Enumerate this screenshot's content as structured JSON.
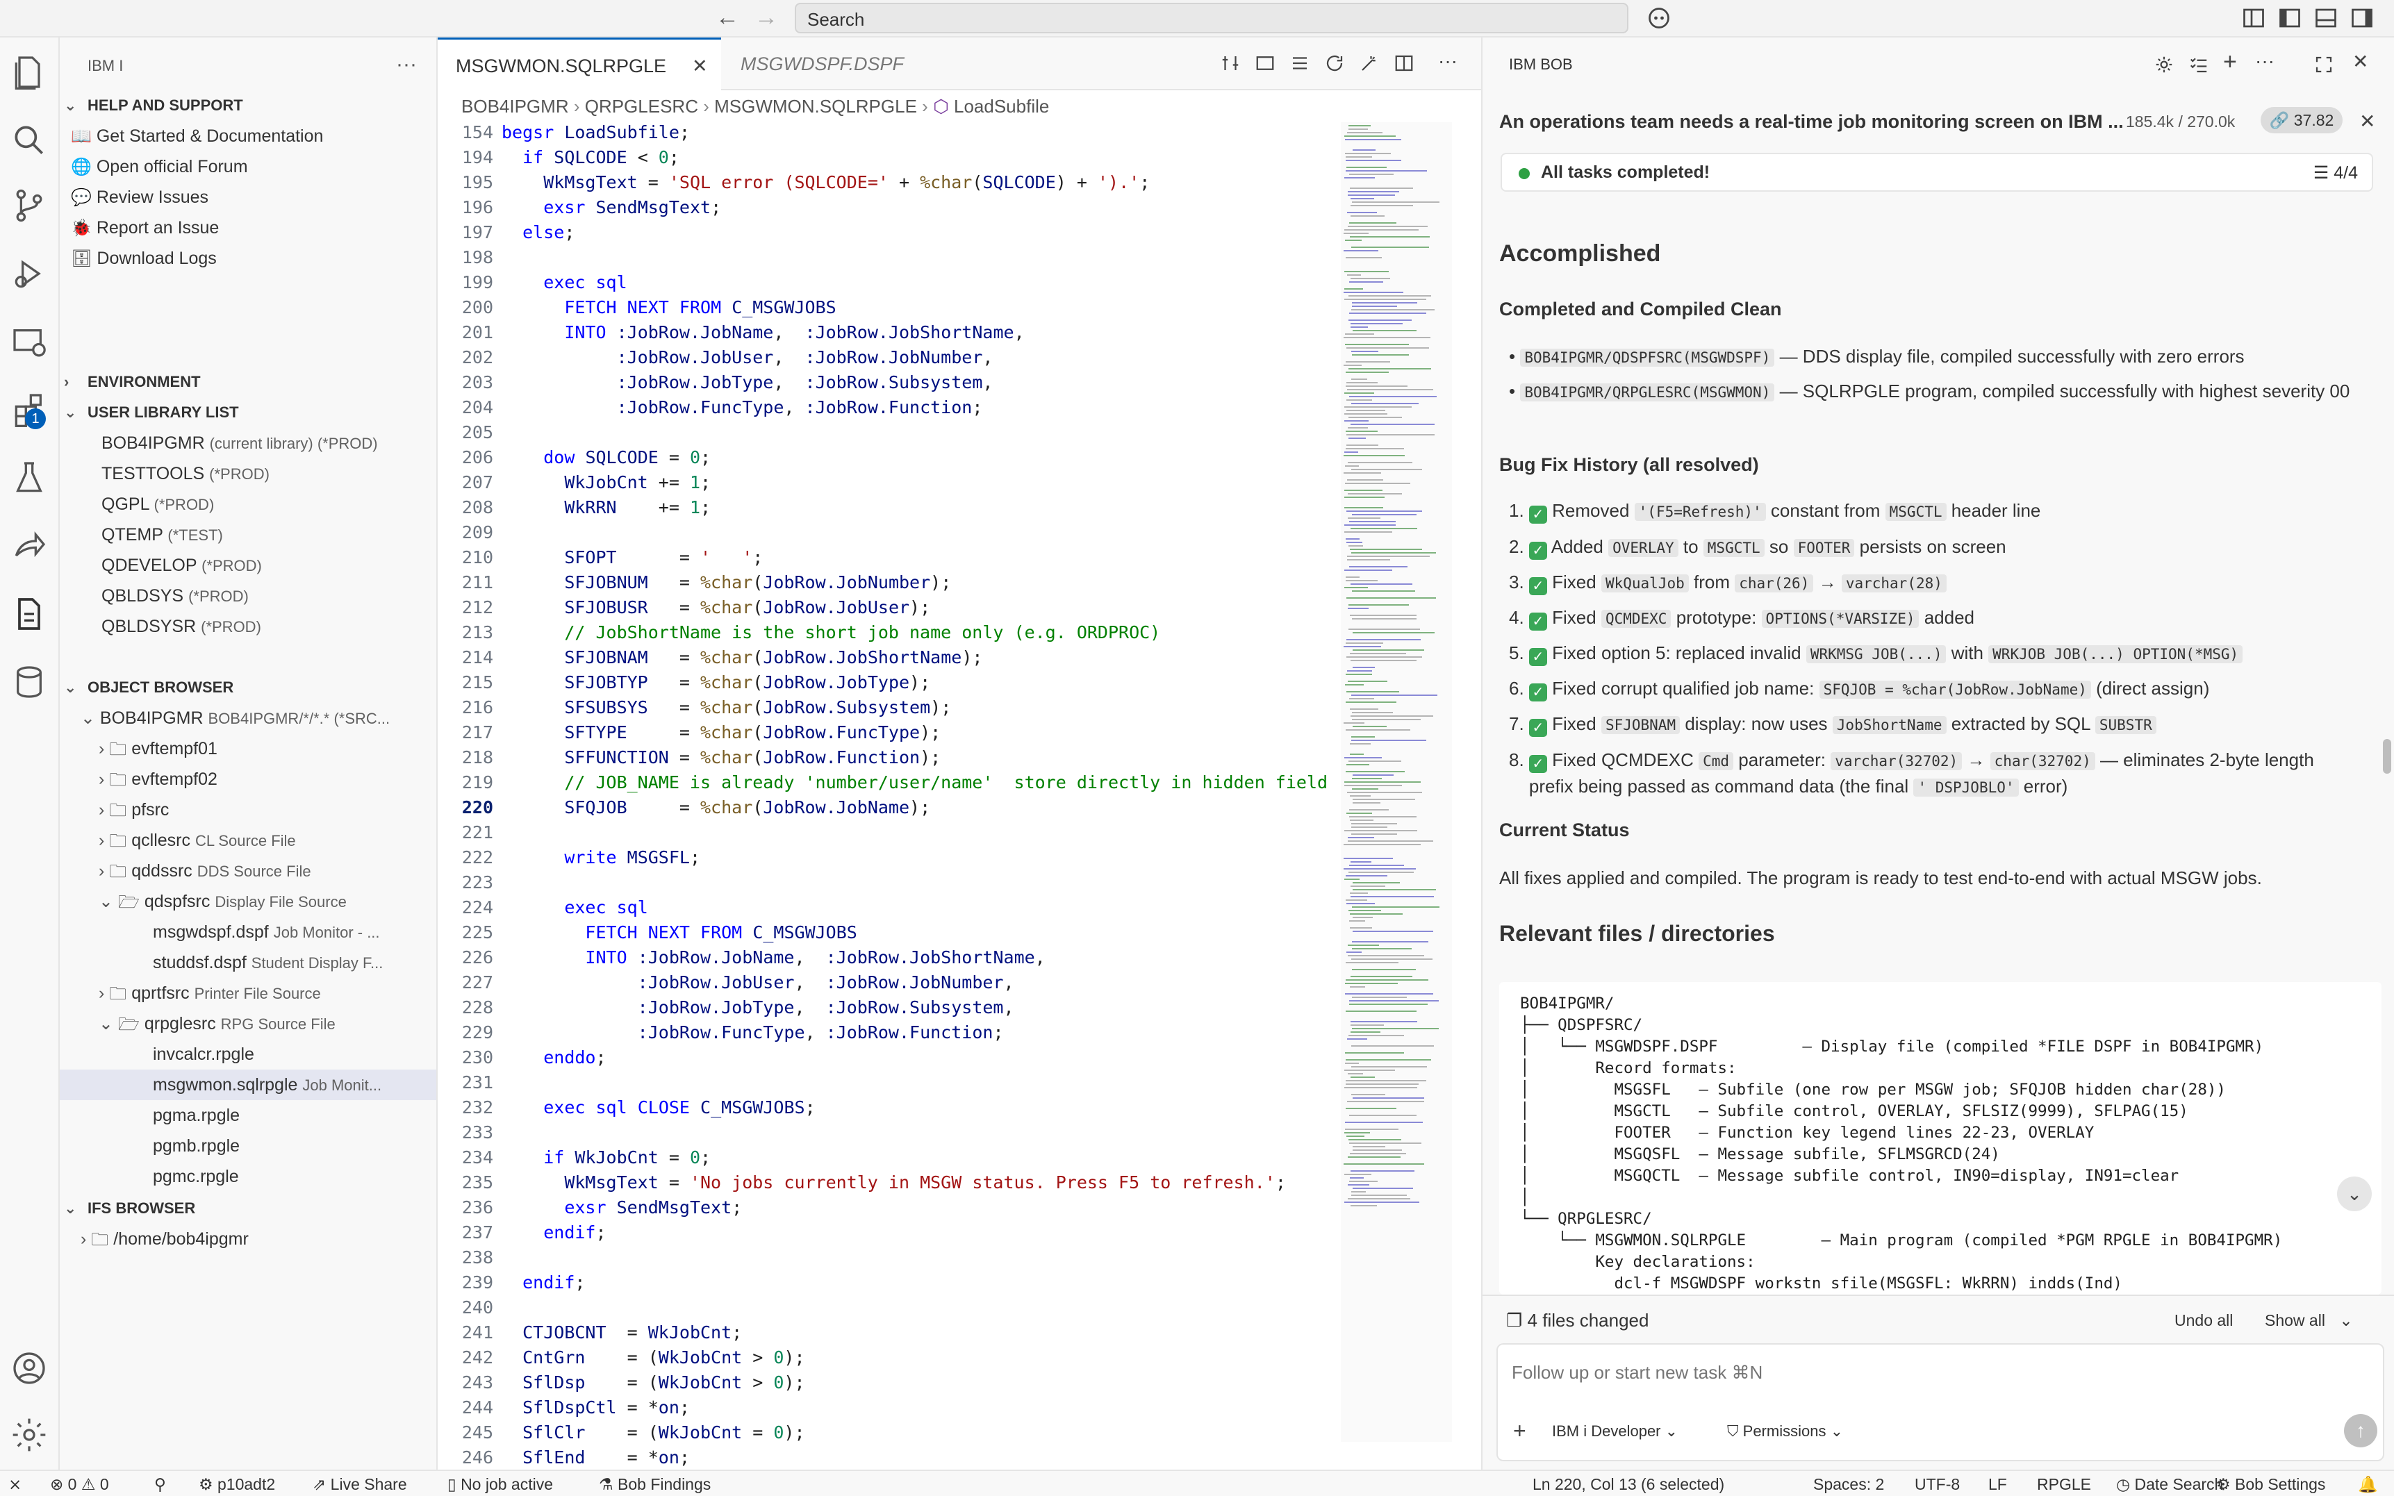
{
  "titlebar": {
    "search": "Search"
  },
  "activity": {
    "extensions_badge": "1"
  },
  "sidebar": {
    "title": "IBM I",
    "help": {
      "header": "HELP AND SUPPORT",
      "items": [
        "Get Started & Documentation",
        "Open official Forum",
        "Review Issues",
        "Report an Issue",
        "Download Logs"
      ]
    },
    "environment": "ENVIRONMENT",
    "library_list": {
      "header": "USER LIBRARY LIST",
      "items": [
        {
          "name": "BOB4IPGMR",
          "desc": "(current library) (*PROD)"
        },
        {
          "name": "TESTTOOLS",
          "desc": "(*PROD)"
        },
        {
          "name": "QGPL",
          "desc": "(*PROD)"
        },
        {
          "name": "QTEMP",
          "desc": "(*TEST)"
        },
        {
          "name": "QDEVELOP",
          "desc": "(*PROD)"
        },
        {
          "name": "QBLDSYS",
          "desc": "(*PROD)"
        },
        {
          "name": "QBLDSYSR",
          "desc": "(*PROD)"
        }
      ]
    },
    "object_browser": {
      "header": "OBJECT BROWSER",
      "root": {
        "name": "BOB4IPGMR",
        "desc": "BOB4IPGMR/*/*.* (*SRC..."
      },
      "items": [
        {
          "name": "evftempf01",
          "desc": ""
        },
        {
          "name": "evftempf02",
          "desc": ""
        },
        {
          "name": "pfsrc",
          "desc": ""
        },
        {
          "name": "qcllesrc",
          "desc": "CL Source File"
        },
        {
          "name": "qddssrc",
          "desc": "DDS Source File"
        },
        {
          "name": "qdspfsrc",
          "desc": "Display File Source"
        },
        {
          "name": "msgwdspf.dspf",
          "desc": "Job Monitor - ..."
        },
        {
          "name": "studdsf.dspf",
          "desc": "Student Display F..."
        },
        {
          "name": "qprtfsrc",
          "desc": "Printer File Source"
        },
        {
          "name": "qrpglesrc",
          "desc": "RPG Source File"
        },
        {
          "name": "invcalcr.rpgle",
          "desc": ""
        },
        {
          "name": "msgwmon.sqlrpgle",
          "desc": "Job Monit..."
        },
        {
          "name": "pgma.rpgle",
          "desc": ""
        },
        {
          "name": "pgmb.rpgle",
          "desc": ""
        },
        {
          "name": "pgmc.rpgle",
          "desc": ""
        }
      ]
    },
    "ifs": {
      "header": "IFS BROWSER",
      "path": "/home/bob4ipgmr"
    }
  },
  "editor": {
    "tabs": [
      "MSGWMON.SQLRPGLE",
      "MSGWDSPF.DSPF"
    ],
    "breadcrumb": [
      "BOB4IPGMR",
      "QRPGLESRC",
      "MSGWMON.SQLRPGLE",
      "LoadSubfile"
    ],
    "line_numbers": [
      "154",
      "194",
      "195",
      "196",
      "197",
      "198",
      "199",
      "200",
      "201",
      "202",
      "203",
      "204",
      "205",
      "206",
      "207",
      "208",
      "209",
      "210",
      "211",
      "212",
      "213",
      "214",
      "215",
      "216",
      "217",
      "218",
      "219",
      "220",
      "221",
      "222",
      "223",
      "224",
      "225",
      "226",
      "227",
      "228",
      "229",
      "230",
      "231",
      "232",
      "233",
      "234",
      "235",
      "236",
      "237",
      "238",
      "239",
      "240",
      "241",
      "242",
      "243",
      "244",
      "245",
      "246"
    ],
    "current_line": "220"
  },
  "bob": {
    "panel_title": "IBM BOB",
    "task_title": "An operations team needs a real-time job monitoring screen on IBM ...",
    "tokens": "185.4k / 270.0k",
    "cost": "37.82",
    "tasks_status": "All tasks completed!",
    "tasks_count": "4/4",
    "accomplished": "Accomplished",
    "compiled_header": "Completed and Compiled Clean",
    "compiled": [
      {
        "code": "BOB4IPGMR/QDSPFSRC(MSGWDSPF)",
        "text": " — DDS display file, compiled successfully with zero errors"
      },
      {
        "code": "BOB4IPGMR/QRPGLESRC(MSGWMON)",
        "text": " — SQLRPGLE program, compiled successfully with highest severity 00"
      }
    ],
    "bugfix_header": "Bug Fix History (all resolved)",
    "current_status_header": "Current Status",
    "current_status": "All fixes applied and compiled. The program is ready to test end-to-end with actual MSGW jobs.",
    "relevant_header": "Relevant files / directories",
    "files_changed": "4 files changed",
    "undo_all": "Undo all",
    "show_all": "Show all",
    "composer_placeholder": "Follow up or start new task ⌘N",
    "mode": "IBM i Developer",
    "permissions": "Permissions"
  },
  "statusbar": {
    "errors": "0",
    "warnings": "0",
    "host": "p10adt2",
    "live_share": "Live Share",
    "job": "No job active",
    "findings": "Bob Findings",
    "position": "Ln 220, Col 13 (6 selected)",
    "spaces": "Spaces: 2",
    "encoding": "UTF-8",
    "eol": "LF",
    "language": "RPGLE",
    "date_search": "Date Search",
    "bob_settings": "Bob Settings"
  },
  "colors": {
    "accent": "#005fb8",
    "success": "#3aa757",
    "selection": "#e4e6f1"
  }
}
